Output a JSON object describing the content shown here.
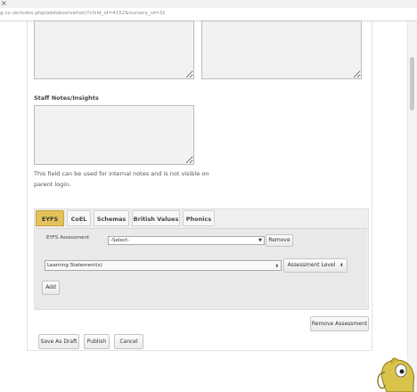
{
  "browser": {
    "url": "g.co.uk/index.php/addobservation/?child_id=4152&nursery_id=31",
    "close_glyph": "×"
  },
  "form": {
    "staff_notes_label": "Staff Notes/Insights",
    "help_line_1": "This field can be used for internal notes and is not visible on",
    "help_line_2": "parent login."
  },
  "assessment": {
    "tabs": [
      {
        "label": "EYFS",
        "active": true
      },
      {
        "label": "CoEL",
        "active": false
      },
      {
        "label": "Schemas",
        "active": false
      },
      {
        "label": "British Values",
        "active": false
      },
      {
        "label": "Phonics",
        "active": false
      }
    ],
    "eyfs_label": "EYFS Assessment",
    "eyfs_select_value": "-Select-",
    "remove_label": "Remove",
    "learning_select_value": "Learning Statement(s)",
    "assessment_level_label": "Assessment Level",
    "add_label": "Add",
    "remove_assessment_label": "Remove Assessment"
  },
  "actions": {
    "save_draft_label": "Save As Draft",
    "publish_label": "Publish",
    "cancel_label": "Cancel"
  },
  "colors": {
    "active_tab": "#e3c25a",
    "mascot": "#d9c34a"
  },
  "icons": {
    "dropdown": "caret-down-icon",
    "mascot": "elephant-mascot-icon"
  }
}
